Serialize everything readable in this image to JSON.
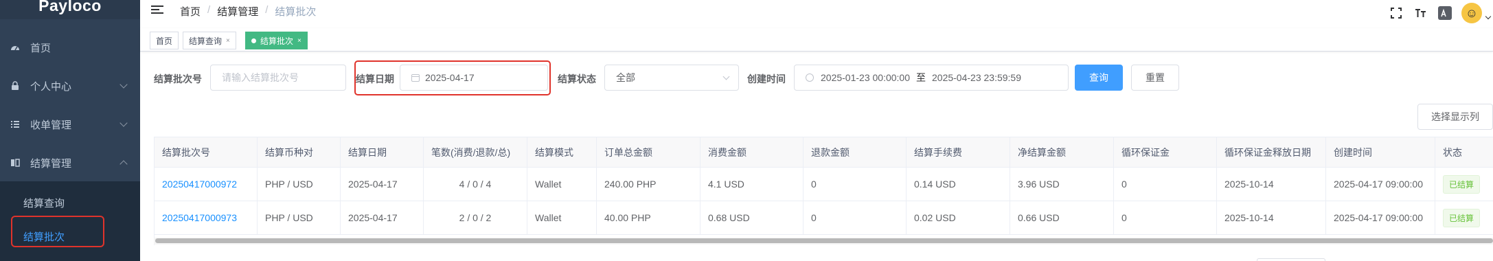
{
  "logo": {
    "text": "Payloco"
  },
  "sidebar": {
    "items": [
      {
        "label": "首页",
        "icon": "dashboard-icon"
      },
      {
        "label": "个人中心",
        "icon": "lock-icon"
      },
      {
        "label": "收单管理",
        "icon": "list-icon"
      },
      {
        "label": "结算管理",
        "icon": "book-icon"
      }
    ],
    "sub_items": [
      {
        "label": "结算查询"
      },
      {
        "label": "结算批次"
      }
    ]
  },
  "breadcrumb": {
    "home": "首页",
    "section": "结算管理",
    "current": "结算批次",
    "separator": "/"
  },
  "navbar_icons": [
    "fullscreen-icon",
    "font-size-icon",
    "translate-icon",
    "avatar"
  ],
  "tags": [
    {
      "label": "首页"
    },
    {
      "label": "结算查询",
      "close": "×"
    },
    {
      "label": "结算批次",
      "close": "×"
    }
  ],
  "filters": {
    "batch_no": {
      "label": "结算批次号",
      "placeholder": "请输入结算批次号"
    },
    "settle_date": {
      "label": "结算日期",
      "value": "2025-04-17"
    },
    "status": {
      "label": "结算状态",
      "value": "全部"
    },
    "created": {
      "label": "创建时间",
      "start": "2025-01-23 00:00:00",
      "to": "至",
      "end": "2025-04-23 23:59:59"
    },
    "search_button": "查询",
    "reset_button": "重置"
  },
  "columns_button": "选择显示列",
  "table": {
    "headers": [
      "结算批次号",
      "结算币种对",
      "结算日期",
      "笔数(消费/退款/总)",
      "结算模式",
      "订单总金额",
      "消费金额",
      "退款金额",
      "结算手续费",
      "净结算金额",
      "循环保证金",
      "循环保证金释放日期",
      "创建时间",
      "状态"
    ],
    "rows": [
      [
        "20250417000972",
        "PHP / USD",
        "2025-04-17",
        "4 / 0 / 4",
        "Wallet",
        "240.00 PHP",
        "4.1 USD",
        "0",
        "0.14 USD",
        "3.96 USD",
        "0",
        "2025-10-14",
        "2025-04-17 09:00:00",
        "已结算"
      ],
      [
        "20250417000973",
        "PHP / USD",
        "2025-04-17",
        "2 / 0 / 2",
        "Wallet",
        "40.00 PHP",
        "0.68 USD",
        "0",
        "0.02 USD",
        "0.66 USD",
        "0",
        "2025-10-14",
        "2025-04-17 09:00:00",
        "已结算"
      ]
    ]
  },
  "colors": {
    "sidebar_bg": "#304156",
    "primary": "#409eff",
    "tag_active": "#42b983",
    "highlight": "#e0332b",
    "success": "#67c23a"
  }
}
